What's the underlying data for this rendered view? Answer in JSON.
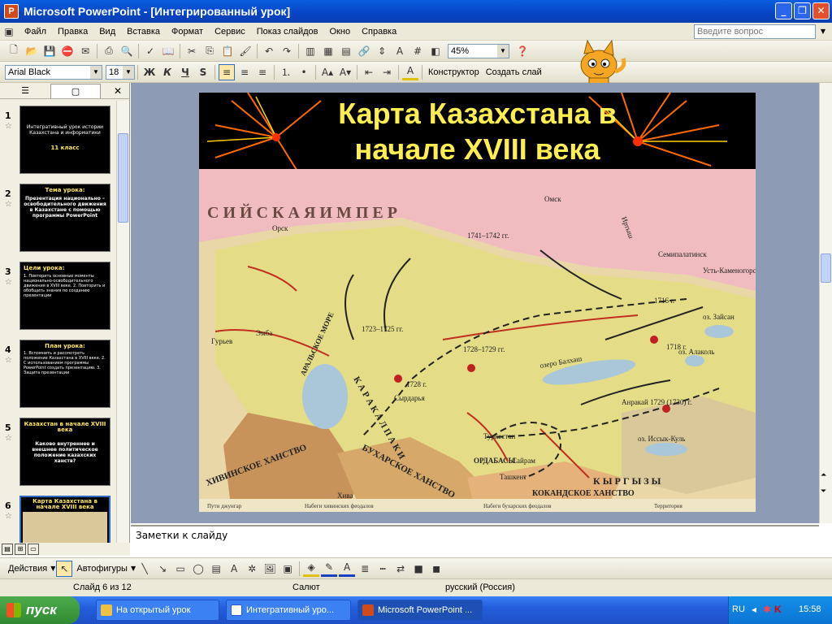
{
  "window": {
    "title": "Microsoft PowerPoint - [Интегрированный урок]",
    "app_icon": "P"
  },
  "menu": [
    "Файл",
    "Правка",
    "Вид",
    "Вставка",
    "Формат",
    "Сервис",
    "Показ слайдов",
    "Окно",
    "Справка"
  ],
  "ask_box": {
    "placeholder": "Введите вопрос"
  },
  "toolbar": {
    "zoom": "45%",
    "font_name": "Arial Black",
    "font_size": "18",
    "bold": "Ж",
    "italic": "К",
    "underline": "Ч",
    "shadow": "S",
    "designer": "Конструктор",
    "new_slide": "Создать слай"
  },
  "slides": [
    {
      "num": "1",
      "title": "Интегративный урок истории Казахстана и информатики",
      "sub": "11 класс"
    },
    {
      "num": "2",
      "title": "Тема урока:",
      "sub": "Презентация национально – освободительного движения в Казахстане с помощью программы PowerPoint"
    },
    {
      "num": "3",
      "title": "Цели урока:",
      "sub": "1. Повторить основные моменты национально-освободительного движения в XVIII веке. 2. Повторить и обобщить знания по созданию презентации"
    },
    {
      "num": "4",
      "title": "План урока:",
      "sub": "1. Вспомнить и рассмотреть положение Казахстана в XVIII веке. 2. С использованием программы PowerPoint создать презентацию. 3. Защита презентации"
    },
    {
      "num": "5",
      "title": "Казахстан в начале XVIII века",
      "sub": "Каково внутреннее и внешнее политическое положение казахских ханств?"
    },
    {
      "num": "6",
      "title": "Карта Казахстана в начале XVIII века",
      "sub": ""
    }
  ],
  "current_slide": {
    "title_line1": "Карта Казахстана в",
    "title_line2": "начале XVIII века",
    "map_labels": {
      "empire": "С И Й С К А Я   И М П Е Р",
      "aral": "АРАЛЬСКОЕ МОРЕ",
      "khiva": "ХИВИНСКОЕ ХАНСТВО",
      "bukhara": "БУХАРСКОЕ ХАНСТВО",
      "kokand": "КОКАНДСКОЕ ХАНСТВО",
      "karakalpaki": "К А Р А К А Л П А К И",
      "kyrgyzy": "К Ы Р Г Ы З Ы",
      "ordabasy": "ОРДАБАСЫ",
      "turkestan": "Туркестан",
      "sairam": "Сайрам",
      "tashkent": "Ташкент",
      "omsk": "Омск",
      "semipalatinsk": "Семипалатинск",
      "ust_kamenogorsk": "Усть-Каменогорск",
      "zaisan": "оз. Зайсан",
      "alakol": "оз. Алаколь",
      "balkhash": "озеро Балхаш",
      "issyk_kul": "оз. Иссык-Куль",
      "orsk": "Орск",
      "guryev": "Гурьев",
      "khiva_city": "Хива",
      "anrakai": "Анракай 1729 (1730) г.",
      "syrdarya": "Сырдарья",
      "emba": "Эмба",
      "irtysh": "Иртыш",
      "year1": "1723–1725 гг.",
      "year2": "1741–1742 гг.",
      "year3": "1728–1729 гг.",
      "year4": "1716 г.",
      "year5": "1718 г.",
      "year6": "1728 г.",
      "legend1": "Набеги хивинских феодалов",
      "legend2": "Набеги бухарских феодалов",
      "legend3": "Пути джунгар",
      "legend4": "Территория"
    }
  },
  "notes": {
    "placeholder": "Заметки к слайду"
  },
  "drawing": {
    "actions": "Действия",
    "autoshapes": "Автофигуры"
  },
  "status": {
    "slide": "Слайд 6 из 12",
    "design": "Салют",
    "language": "русский (Россия)"
  },
  "taskbar": {
    "start": "пуск",
    "tasks": [
      "На открытый урок",
      "Интегративный уро...",
      "Microsoft PowerPoint ..."
    ],
    "lang": "RU",
    "time": "15:58"
  },
  "colors": {
    "accent": "#0a5fe0",
    "title_yellow": "#ffee50",
    "start_green": "#3a9a3a"
  }
}
